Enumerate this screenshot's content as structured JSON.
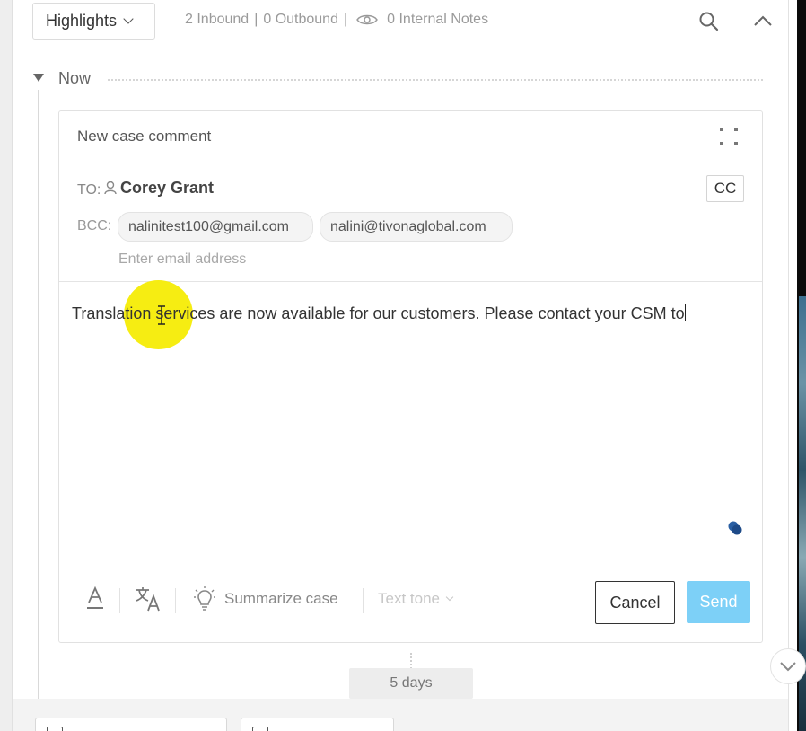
{
  "header": {
    "filter_label": "Highlights",
    "inbound": "2 Inbound",
    "outbound": "0 Outbound",
    "internal_notes": "0 Internal Notes",
    "separator": "|"
  },
  "timeline": {
    "now_label": "Now",
    "gap_label": "5 days"
  },
  "composer": {
    "title": "New case comment",
    "to_label": "TO:",
    "to_name": "Corey Grant",
    "cc_label": "CC",
    "bcc_label": "BCC:",
    "bcc_recipients": [
      "nalinitest100@gmail.com",
      "nalini@tivonaglobal.com"
    ],
    "email_placeholder": "Enter email address",
    "body_text": "Translation services are now available for our customers. Please contact your CSM to"
  },
  "toolbar": {
    "font_color_icon": "font-color-icon",
    "translate_icon": "translate-icon",
    "summarize_icon": "lightbulb-icon",
    "summarize_label": "Summarize case",
    "tone_label": "Text tone",
    "cancel_label": "Cancel",
    "send_label": "Send"
  },
  "colors": {
    "send_button": "#7dd0f7",
    "cursor_highlight": "#f6ed12",
    "assist_dot": "#2a5fa3"
  }
}
